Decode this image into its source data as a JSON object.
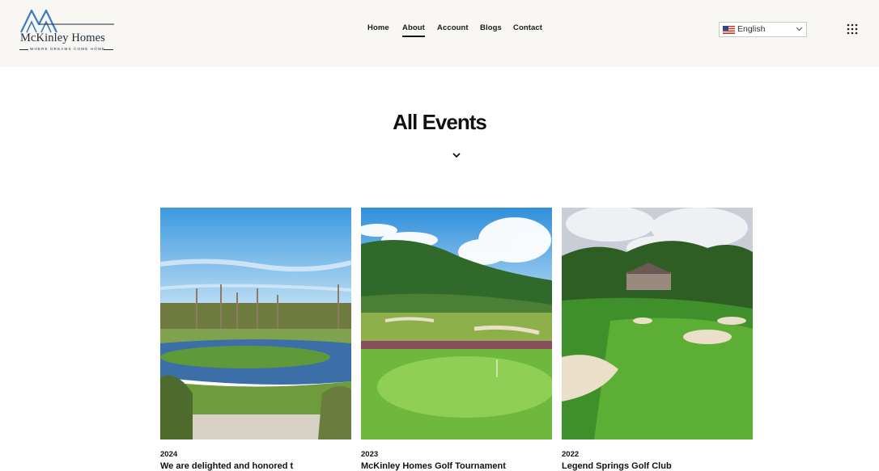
{
  "header": {
    "logo": {
      "name": "McKinley Homes",
      "tagline": "WHERE DREAMS COME HOME"
    },
    "nav": [
      {
        "label": "Home",
        "active": false
      },
      {
        "label": "About",
        "active": true
      },
      {
        "label": "Account",
        "active": false
      },
      {
        "label": "Blogs",
        "active": false
      },
      {
        "label": "Contact",
        "active": false
      }
    ],
    "language": {
      "selected": "English",
      "flag_icon": "us-flag-icon"
    },
    "menu_icon": "grid-menu-icon"
  },
  "main": {
    "title": "All Events",
    "cards": [
      {
        "year": "2024",
        "title": "We are delighted and honored t",
        "image": "golf-course-lake-image"
      },
      {
        "year": "2023",
        "title": "McKinley Homes Golf Tournament",
        "image": "golf-course-mountain-image"
      },
      {
        "year": "2022",
        "title": "Legend Springs Golf Club",
        "image": "golf-course-bunkers-image"
      }
    ]
  },
  "colors": {
    "header_bg": "#f8f7f3",
    "logo_blue": "#3a7cc0",
    "text": "#111111"
  }
}
